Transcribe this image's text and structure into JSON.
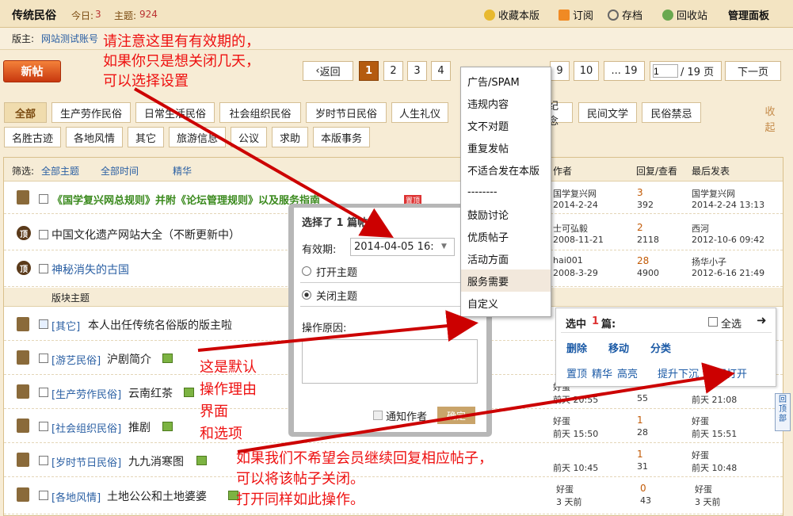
{
  "header": {
    "forum_name": "传统民俗",
    "today_label": "今日:",
    "today_count": "3",
    "topics_label": "主题:",
    "topics_count": "924",
    "favorite": "收藏本版",
    "subscribe": "订阅",
    "archive": "存档",
    "recycle": "回收站",
    "admin": "管理面板"
  },
  "moderator": {
    "label": "版主:",
    "name": "网站测试账号"
  },
  "toolbar": {
    "new_post": "新帖",
    "back": "返回",
    "pages": [
      "1",
      "2",
      "3",
      "4",
      "9",
      "10",
      "... 19"
    ],
    "page_input": "1",
    "page_total": "/ 19 页",
    "next": "下一页"
  },
  "categories_row1": [
    "全部",
    "生产劳作民俗",
    "日常生活民俗",
    "社会组织民俗",
    "岁时节日民俗",
    "人生礼仪",
    "纪念",
    "民间文学",
    "民俗禁忌"
  ],
  "categories_row2": [
    "名胜古迹",
    "各地风情",
    "其它",
    "旅游信息",
    "公议",
    "求助",
    "本版事务"
  ],
  "collapse": "收起",
  "filter": {
    "label": "筛选:",
    "all_topics": "全部主题",
    "all_time": "全部时间",
    "digest": "精华",
    "col_author": "作者",
    "col_replies": "回复/查看",
    "col_last": "最后发表"
  },
  "pinned": [
    {
      "title": "《国学复兴网总规则》并附《论坛管理规则》以及服务指南",
      "hot": "置顶",
      "author": "国学复兴网",
      "date": "2014-2-24",
      "replies": "3",
      "views": "392",
      "last_user": "国学复兴网",
      "last_time": "2014-2-24 13:13"
    },
    {
      "title": "中国文化遗产网站大全（不断更新中）",
      "author": "士可弘毅",
      "date": "2008-11-21",
      "replies": "2",
      "views": "2118",
      "last_user": "西河",
      "last_time": "2012-10-6 09:42"
    },
    {
      "title": "神秘消失的古国",
      "author": "hai001",
      "date": "2008-3-29",
      "replies": "28",
      "views": "4900",
      "last_user": "扬华小子",
      "last_time": "2012-6-16 21:49"
    }
  ],
  "section_label": "版块主题",
  "threads": [
    {
      "tag": "[其它]",
      "title": "本人出任传统名俗版的版主啦"
    },
    {
      "tag": "[游艺民俗]",
      "title": "沪剧简介"
    },
    {
      "tag": "[生产劳作民俗]",
      "title": "云南红茶",
      "author": "好蛋",
      "date": "前天 20:55",
      "replies": "55",
      "last_user": "前天 21:08"
    },
    {
      "tag": "[社会组织民俗]",
      "title": "推剧",
      "author": "好蛋",
      "date": "前天 15:50",
      "replies": "1",
      "views": "28",
      "last_user": "好蛋",
      "last_time": "前天 15:51"
    },
    {
      "tag": "[岁时节日民俗]",
      "title": "九九消寒图",
      "author": "",
      "date": "前天 10:45",
      "replies": "1",
      "views": "31",
      "last_user": "好蛋",
      "last_time": "前天 10:48"
    },
    {
      "tag": "[各地风情]",
      "title": "土地公公和土地婆婆",
      "author": "好蛋",
      "date": "3 天前",
      "replies": "0",
      "views": "43",
      "last_user": "好蛋",
      "last_time": "3 天前"
    }
  ],
  "dialog": {
    "title": "选择了 1 篇帖子",
    "expiry_label": "有效期:",
    "expiry_value": "2014-04-05 16:",
    "open": "打开主题",
    "close": "关闭主题",
    "reason_label": "操作原因:",
    "notify": "通知作者",
    "confirm": "确定"
  },
  "menu": [
    "广告/SPAM",
    "违规内容",
    "文不对题",
    "重复发帖",
    "不适合发在本版",
    "--------",
    "鼓励讨论",
    "优质帖子",
    "活动方面",
    "服务需要",
    "自定义"
  ],
  "selection": {
    "label": "选中",
    "count": "1",
    "unit": "篇:",
    "select_all": "全选",
    "delete": "删除",
    "move": "移动",
    "classify": "分类",
    "top": "置顶",
    "digest": "精华",
    "highlight": "高亮",
    "bump": "提升下沉",
    "close_open": "关闭打开"
  },
  "back_top": "回顶部",
  "annotations": {
    "a1": "请注意这里有有效期的，\n如果你只是想关闭几天，\n可以选择设置",
    "a2": "这是默认\n操作理由\n界面\n和选项",
    "a3": "如果我们不希望会员继续回复相应帖子，\n可以将该帖子关闭。\n打开同样如此操作。"
  }
}
